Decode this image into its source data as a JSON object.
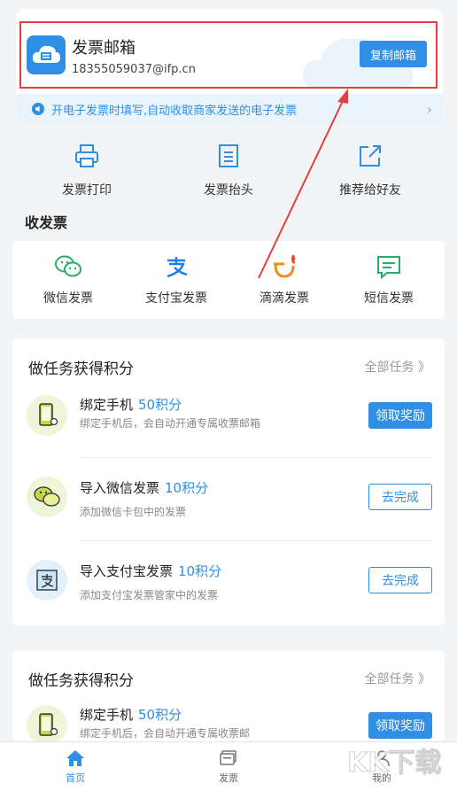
{
  "mailbox": {
    "title": "发票邮箱",
    "address": "18355059037@ifp.cn",
    "copy_label": "复制邮箱",
    "notice": "开电子发票时填写,自动收取商家发送的电子发票"
  },
  "tools": [
    {
      "label": "发票打印",
      "icon": "printer-icon"
    },
    {
      "label": "发票抬头",
      "icon": "document-icon"
    },
    {
      "label": "推荐给好友",
      "icon": "share-icon"
    }
  ],
  "receive": {
    "title": "收发票",
    "items": [
      {
        "label": "微信发票",
        "icon": "wechat-icon"
      },
      {
        "label": "支付宝发票",
        "icon": "alipay-icon"
      },
      {
        "label": "滴滴发票",
        "icon": "didi-icon"
      },
      {
        "label": "短信发票",
        "icon": "sms-icon"
      }
    ]
  },
  "tasks": {
    "title": "做任务获得积分",
    "all_label": "全部任务 》",
    "items": [
      {
        "name": "绑定手机",
        "points": "50积分",
        "desc": "绑定手机后，会自动开通专属收票邮箱",
        "button": "领取奖励"
      },
      {
        "name": "导入微信发票",
        "points": "10积分",
        "desc": "添加微信卡包中的发票",
        "button": "去完成"
      },
      {
        "name": "导入支付宝发票",
        "points": "10积分",
        "desc": "添加支付宝发票管家中的发票",
        "button": "去完成"
      }
    ]
  },
  "tasks2": {
    "title": "做任务获得积分",
    "all_label": "全部任务 》",
    "items": [
      {
        "name": "绑定手机",
        "points": "50积分",
        "desc": "绑定手机后，会自动开通专属收票邮",
        "button": "领取奖励"
      }
    ]
  },
  "tabbar": [
    {
      "label": "首页",
      "icon": "home-icon",
      "active": true
    },
    {
      "label": "发票",
      "icon": "invoice-icon",
      "active": false
    },
    {
      "label": "我的",
      "icon": "user-icon",
      "active": false
    }
  ],
  "watermark": {
    "url": "www.kkx.net"
  },
  "colors": {
    "accent": "#2f8fe4",
    "highlight": "#e53e3e",
    "background": "#f3f4f6"
  }
}
